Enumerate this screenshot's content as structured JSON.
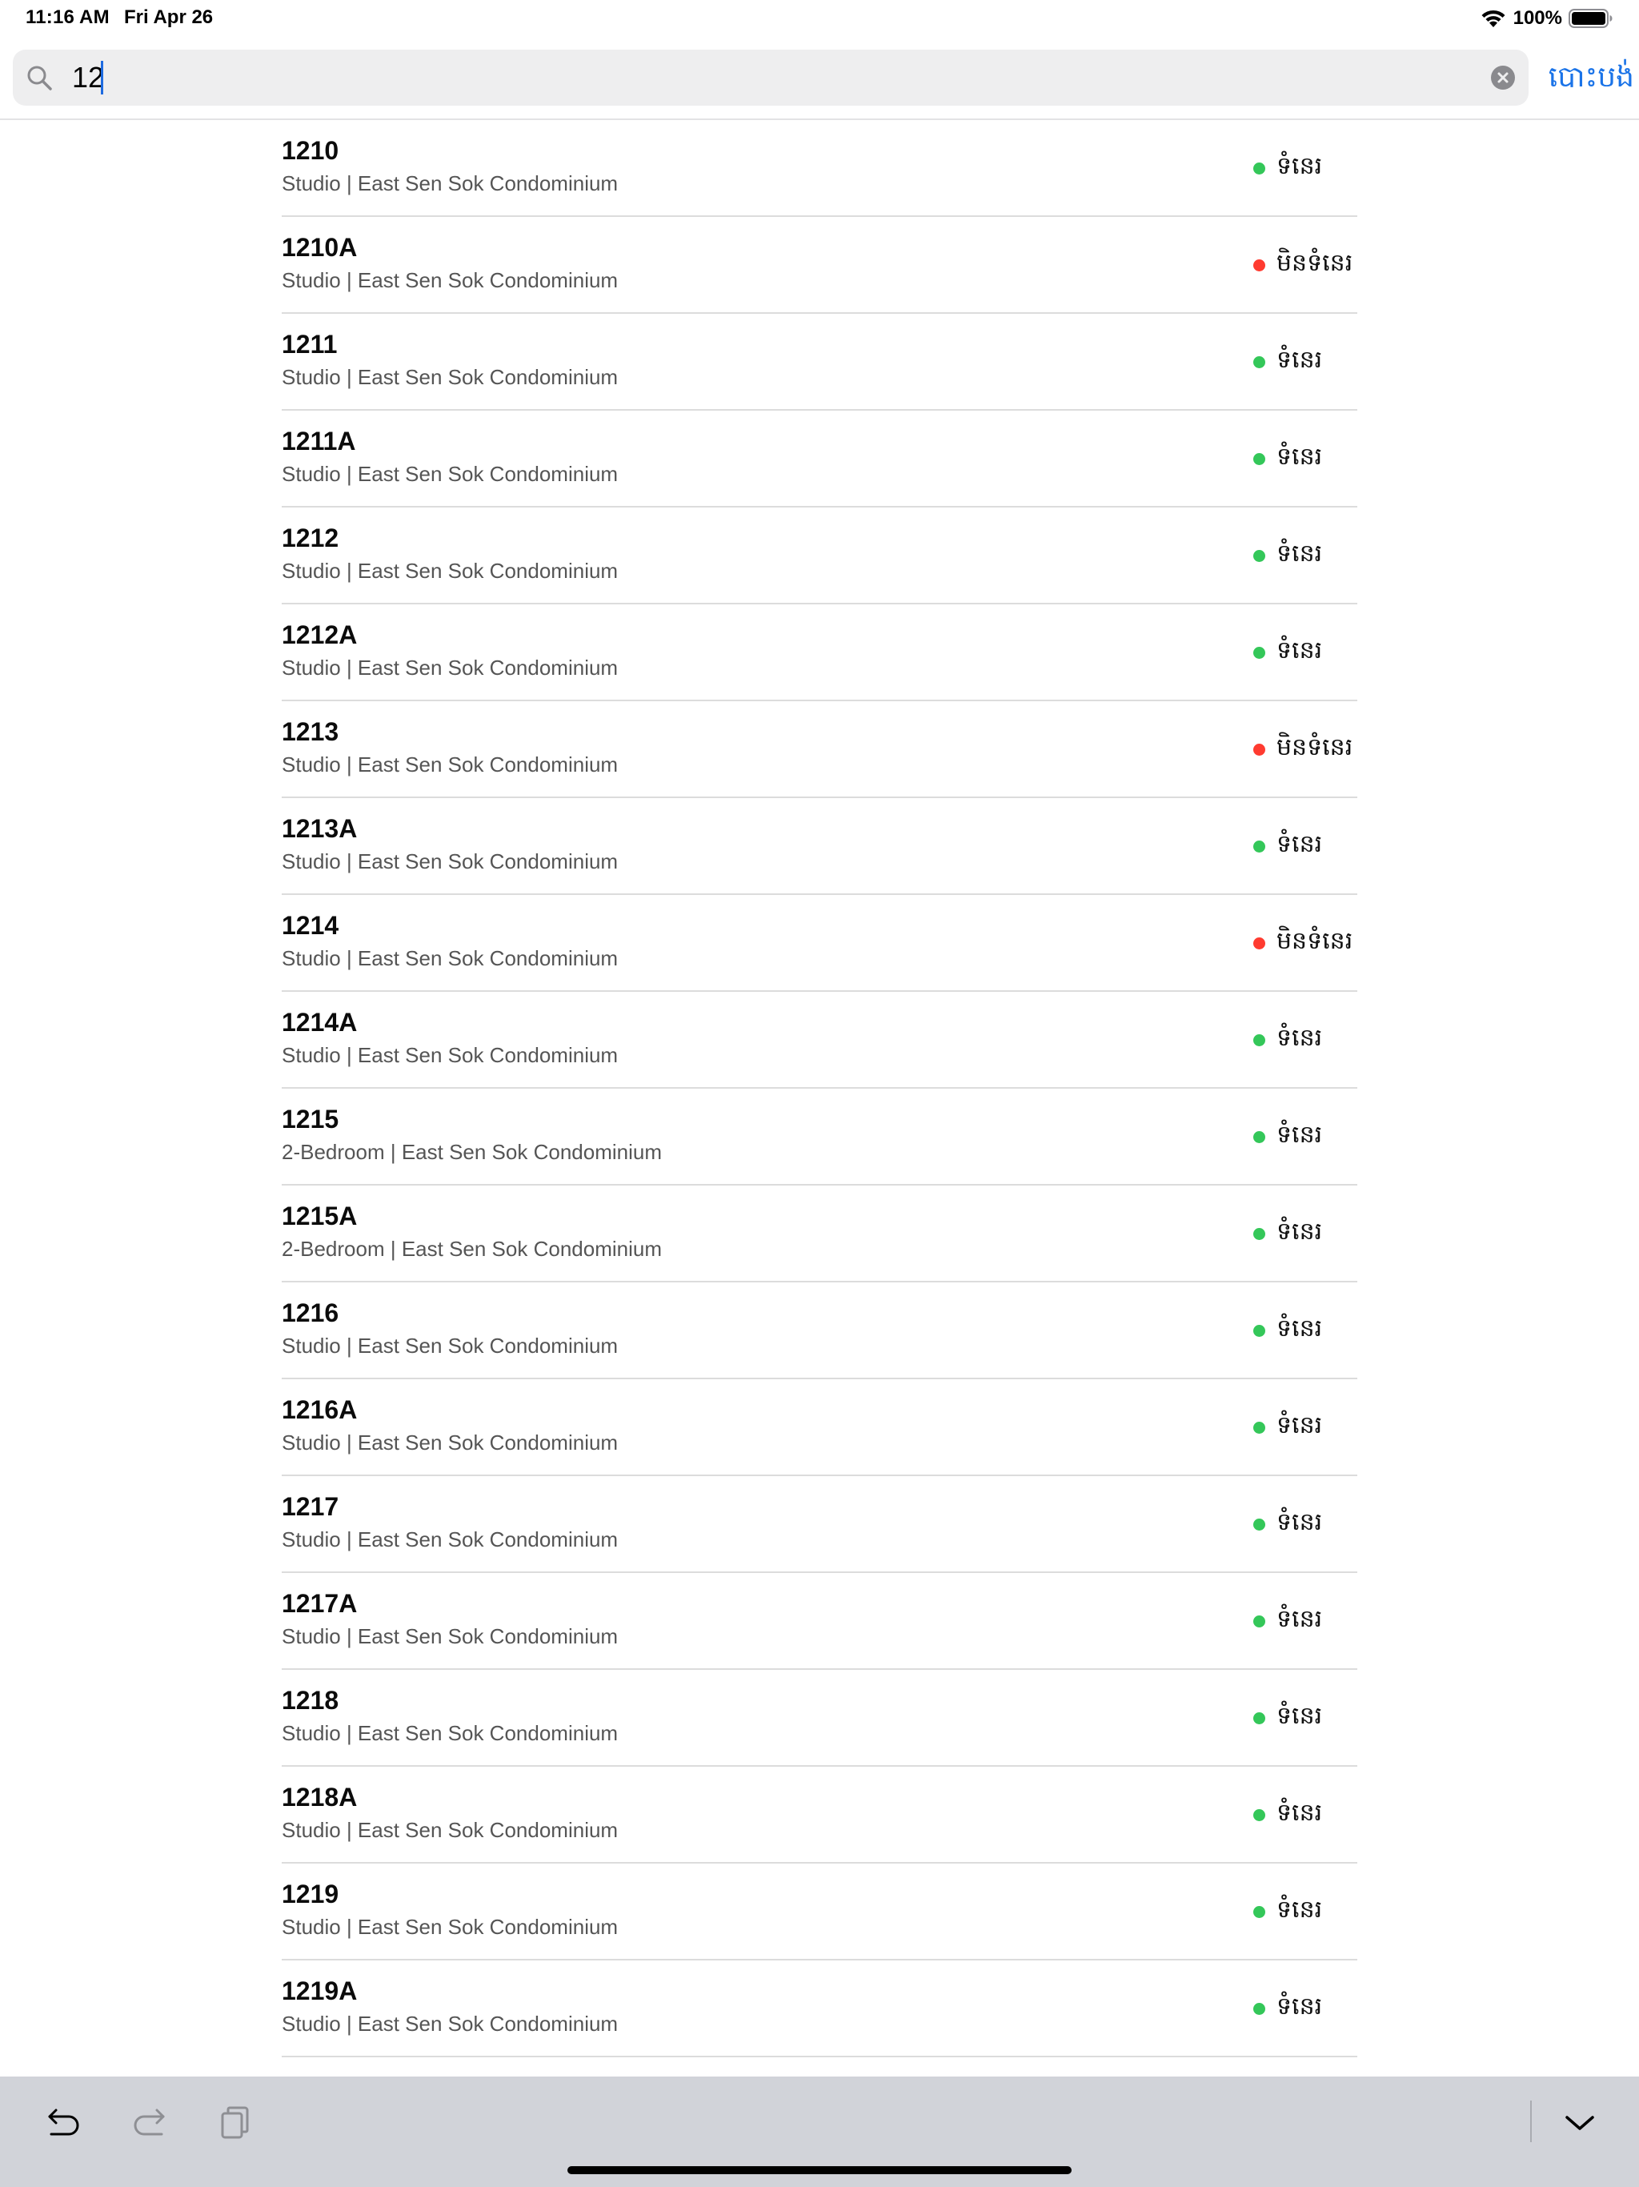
{
  "status_bar": {
    "time": "11:16 AM",
    "date": "Fri Apr 26",
    "battery": "100%",
    "icons": [
      "wifi-icon",
      "battery-icon"
    ]
  },
  "search": {
    "value": "12",
    "cancel_label": "បោះបង់",
    "icons": [
      "search-icon",
      "clear-icon"
    ]
  },
  "colors": {
    "available": "#34c759",
    "unavailable": "#ff3b30",
    "accent": "#1a73e8",
    "toolbar_bg": "#d1d3d9"
  },
  "units": [
    {
      "number": "1210",
      "detail": "Studio | East Sen Sok Condominium",
      "status": "ទំនេរ",
      "available": true
    },
    {
      "number": "1210A",
      "detail": "Studio | East Sen Sok Condominium",
      "status": "មិនទំនេរ",
      "available": false
    },
    {
      "number": "1211",
      "detail": "Studio | East Sen Sok Condominium",
      "status": "ទំនេរ",
      "available": true
    },
    {
      "number": "1211A",
      "detail": "Studio | East Sen Sok Condominium",
      "status": "ទំនេរ",
      "available": true
    },
    {
      "number": "1212",
      "detail": "Studio | East Sen Sok Condominium",
      "status": "ទំនេរ",
      "available": true
    },
    {
      "number": "1212A",
      "detail": "Studio | East Sen Sok Condominium",
      "status": "ទំនេរ",
      "available": true
    },
    {
      "number": "1213",
      "detail": "Studio | East Sen Sok Condominium",
      "status": "មិនទំនេរ",
      "available": false
    },
    {
      "number": "1213A",
      "detail": "Studio | East Sen Sok Condominium",
      "status": "ទំនេរ",
      "available": true
    },
    {
      "number": "1214",
      "detail": "Studio | East Sen Sok Condominium",
      "status": "មិនទំនេរ",
      "available": false
    },
    {
      "number": "1214A",
      "detail": "Studio | East Sen Sok Condominium",
      "status": "ទំនេរ",
      "available": true
    },
    {
      "number": "1215",
      "detail": "2-Bedroom | East Sen Sok Condominium",
      "status": "ទំនេរ",
      "available": true
    },
    {
      "number": "1215A",
      "detail": "2-Bedroom | East Sen Sok Condominium",
      "status": "ទំនេរ",
      "available": true
    },
    {
      "number": "1216",
      "detail": "Studio | East Sen Sok Condominium",
      "status": "ទំនេរ",
      "available": true
    },
    {
      "number": "1216A",
      "detail": "Studio | East Sen Sok Condominium",
      "status": "ទំនេរ",
      "available": true
    },
    {
      "number": "1217",
      "detail": "Studio | East Sen Sok Condominium",
      "status": "ទំនេរ",
      "available": true
    },
    {
      "number": "1217A",
      "detail": "Studio | East Sen Sok Condominium",
      "status": "ទំនេរ",
      "available": true
    },
    {
      "number": "1218",
      "detail": "Studio | East Sen Sok Condominium",
      "status": "ទំនេរ",
      "available": true
    },
    {
      "number": "1218A",
      "detail": "Studio | East Sen Sok Condominium",
      "status": "ទំនេរ",
      "available": true
    },
    {
      "number": "1219",
      "detail": "Studio | East Sen Sok Condominium",
      "status": "ទំនេរ",
      "available": true
    },
    {
      "number": "1219A",
      "detail": "Studio | East Sen Sok Condominium",
      "status": "ទំនេរ",
      "available": true
    }
  ],
  "keyboard_toolbar": {
    "icons": [
      "undo-icon",
      "redo-icon",
      "paste-icon",
      "chevron-down-icon"
    ]
  }
}
